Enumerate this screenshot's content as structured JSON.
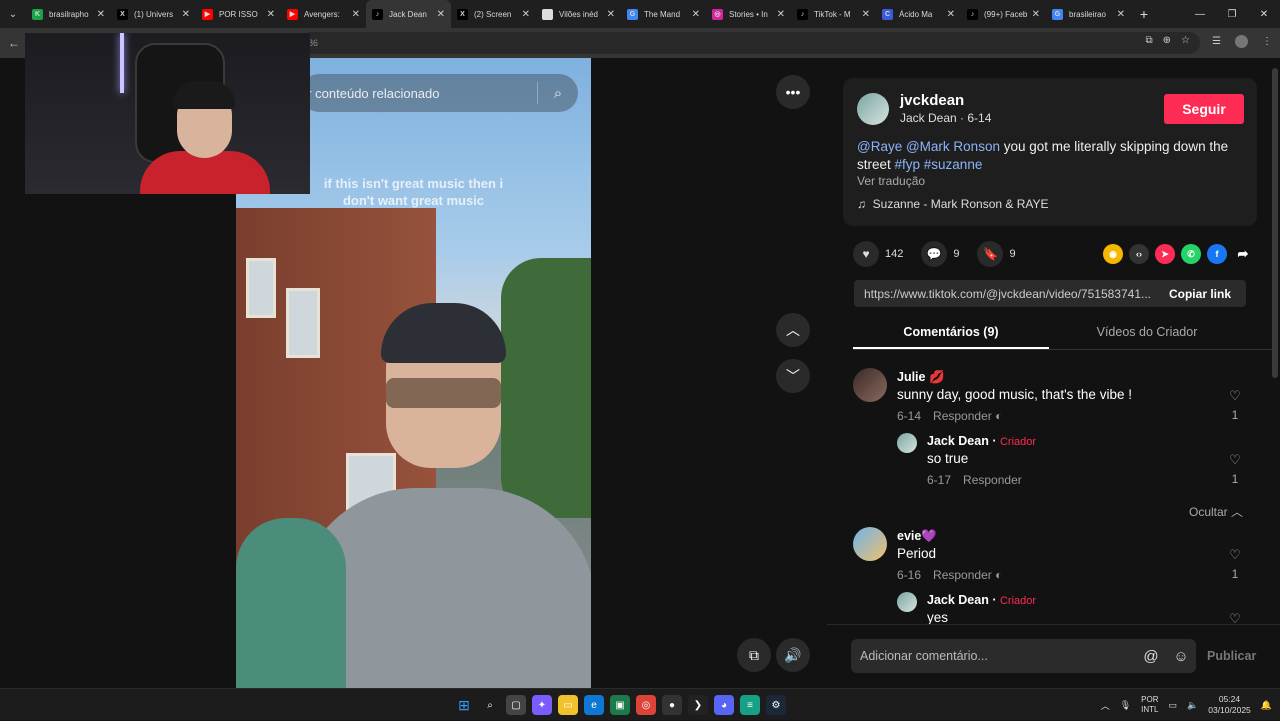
{
  "browser": {
    "tabs": [
      {
        "label": "brasilrapho",
        "fav_color": "#1aa34a",
        "fav_glyph": "K"
      },
      {
        "label": "(1) Univers",
        "fav_color": "#000000",
        "fav_glyph": "X"
      },
      {
        "label": "POR ISSO",
        "fav_color": "#ff0000",
        "fav_glyph": "▶"
      },
      {
        "label": "Avengers:",
        "fav_color": "#ff0000",
        "fav_glyph": "▶"
      },
      {
        "label": "Jack Dean",
        "fav_color": "#000000",
        "fav_glyph": "♪"
      },
      {
        "label": "(2) Screen",
        "fav_color": "#000000",
        "fav_glyph": "X"
      },
      {
        "label": "Vilões inéd",
        "fav_color": "#dddddd",
        "fav_glyph": ""
      },
      {
        "label": "The Mand",
        "fav_color": "#4285f4",
        "fav_glyph": "G"
      },
      {
        "label": "Stories • In",
        "fav_color": "#d6249f",
        "fav_glyph": "◎"
      },
      {
        "label": "TikTok - M",
        "fav_color": "#000000",
        "fav_glyph": "♪"
      },
      {
        "label": "Ácido Ma",
        "fav_color": "#3b5bdb",
        "fav_glyph": "C"
      },
      {
        "label": "(99+) Faceb",
        "fav_color": "#000000",
        "fav_glyph": "♪"
      },
      {
        "label": "brasileirao",
        "fav_color": "#4285f4",
        "fav_glyph": "G"
      }
    ],
    "active_tab_index": 4,
    "new_tab": "+",
    "address_fragment": "86"
  },
  "video": {
    "search_placeholder": "ar conteúdo relacionado",
    "caption_line1": "if this isn't great music then i",
    "caption_line2": "don't want great music"
  },
  "post": {
    "username": "jvckdean",
    "subline": "Jack Dean · 6-14",
    "follow_label": "Seguir",
    "mentions": "@Raye @Mark Ronson",
    "desc_text": " you got me literally skipping down the street ",
    "hashtags": "#fyp #suzanne",
    "translate": "Ver tradução",
    "music": "Suzanne - Mark Ronson & RAYE",
    "likes": "142",
    "comments_count": "9",
    "saves": "9",
    "url": "https://www.tiktok.com/@jvckdean/video/751583741...",
    "copy_link": "Copiar link",
    "tab_comments": "Comentários (9)",
    "tab_creator_videos": "Vídeos do Criador"
  },
  "comments": [
    {
      "name": "Julie 💋",
      "text": "sunny day, good music, that's the vibe !",
      "date": "6-14",
      "reply": "Responder",
      "likes": "1"
    },
    {
      "name": "Jack Dean",
      "creator": "Criador",
      "text": "so true",
      "date": "6-17",
      "reply": "Responder",
      "likes": "1"
    },
    {
      "name": "evie💜",
      "text": "Period",
      "date": "6-16",
      "reply": "Responder",
      "likes": "1"
    },
    {
      "name": "Jack Dean",
      "creator": "Criador",
      "text": "yes",
      "likes": ""
    }
  ],
  "hide_label": "Ocultar",
  "comment_bar": {
    "placeholder": "Adicionar comentário...",
    "publish": "Publicar"
  },
  "taskbar": {
    "lang_line1": "POR",
    "lang_line2": "INTL",
    "time": "05:24",
    "date": "03/10/2025"
  }
}
